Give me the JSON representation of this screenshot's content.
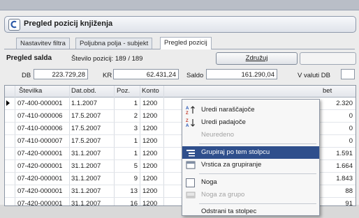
{
  "window": {
    "title": "Pregled pozicij knjiženja",
    "tabs": [
      "Nastavitev filtra",
      "Poljubna polja - subjekt",
      "Pregled pozicij"
    ]
  },
  "toolbar": {
    "section_label": "Pregled salda",
    "count_text": "Število pozicij: 189 / 189",
    "group_button": "Združuj"
  },
  "totals": {
    "db_label": "DB",
    "db_value": "223.729,28",
    "kr_label": "KR",
    "kr_value": "62.431,24",
    "saldo_label": "Saldo",
    "saldo_value": "161.290,04",
    "currency_label": "V valuti DB"
  },
  "grid": {
    "columns": [
      "Številka",
      "Dat.obd.",
      "Poz.",
      "Konto",
      "bet"
    ],
    "rows": [
      {
        "stevilka": "07-400-000001",
        "datum": "1.1.2007",
        "poz": "1",
        "konto": "1200",
        "last": "2.320"
      },
      {
        "stevilka": "07-410-000006",
        "datum": "17.5.2007",
        "poz": "2",
        "konto": "1200",
        "last": "0"
      },
      {
        "stevilka": "07-410-000006",
        "datum": "17.5.2007",
        "poz": "3",
        "konto": "1200",
        "last": "0"
      },
      {
        "stevilka": "07-410-000007",
        "datum": "17.5.2007",
        "poz": "1",
        "konto": "1200",
        "last": "0"
      },
      {
        "stevilka": "07-420-000001",
        "datum": "31.1.2007",
        "poz": "1",
        "konto": "1200",
        "last": "1.591"
      },
      {
        "stevilka": "07-420-000001",
        "datum": "31.1.2007",
        "poz": "5",
        "konto": "1200",
        "last": "1.664"
      },
      {
        "stevilka": "07-420-000001",
        "datum": "31.1.2007",
        "poz": "9",
        "konto": "1200",
        "last": "1.843"
      },
      {
        "stevilka": "07-420-000001",
        "datum": "31.1.2007",
        "poz": "13",
        "konto": "1200",
        "last": "88"
      },
      {
        "stevilka": "07-420-000001",
        "datum": "31.1.2007",
        "poz": "16",
        "konto": "1200",
        "last": "91"
      }
    ]
  },
  "context_menu": {
    "items": [
      {
        "label": "Uredi naraščajoče",
        "icon": "sort-ascending-icon",
        "state": "enabled"
      },
      {
        "label": "Uredi padajoče",
        "icon": "sort-descending-icon",
        "state": "enabled"
      },
      {
        "label": "Neuredeno",
        "icon": "",
        "state": "disabled"
      },
      {
        "label": "Grupiraj po tem stolpcu",
        "icon": "group-by-column-icon",
        "state": "selected"
      },
      {
        "label": "Vrstica za grupiranje",
        "icon": "group-row-icon",
        "state": "enabled"
      },
      {
        "label": "Noga",
        "icon": "footer-checkbox-icon",
        "state": "enabled"
      },
      {
        "label": "Noga za grupo",
        "icon": "group-footer-icon",
        "state": "disabled"
      },
      {
        "label": "Odstrani ta stolpec",
        "icon": "",
        "state": "enabled"
      }
    ]
  }
}
